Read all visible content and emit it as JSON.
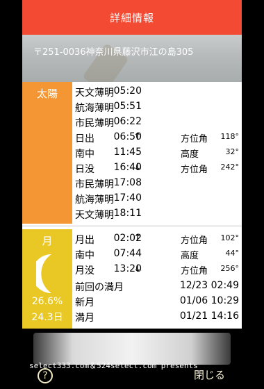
{
  "header": {
    "title": "詳細情報"
  },
  "address": "〒251-0036神奈川県藤沢市江の島305",
  "sun": {
    "label": "太陽",
    "rows": [
      {
        "name": "天文薄明",
        "arrow": "",
        "time": "05:20",
        "ext_label": "",
        "ext_value": ""
      },
      {
        "name": "航海薄明",
        "arrow": "",
        "time": "05:51",
        "ext_label": "",
        "ext_value": ""
      },
      {
        "name": "市民薄明",
        "arrow": "",
        "time": "06:22",
        "ext_label": "",
        "ext_value": ""
      },
      {
        "name": "日出",
        "arrow": "↑",
        "time": "06:50",
        "ext_label": "方位角",
        "ext_value": "118°"
      },
      {
        "name": "南中",
        "arrow": "",
        "time": "11:45",
        "ext_label": "高度",
        "ext_value": "32°"
      },
      {
        "name": "日没",
        "arrow": "↓",
        "time": "16:40",
        "ext_label": "方位角",
        "ext_value": "242°"
      },
      {
        "name": "市民薄明",
        "arrow": "",
        "time": "17:08",
        "ext_label": "",
        "ext_value": ""
      },
      {
        "name": "航海薄明",
        "arrow": "",
        "time": "17:40",
        "ext_label": "",
        "ext_value": ""
      },
      {
        "name": "天文薄明",
        "arrow": "",
        "time": "18:11",
        "ext_label": "",
        "ext_value": ""
      }
    ]
  },
  "moon": {
    "label": "月",
    "illumination": "26.6%",
    "age": "24.3日",
    "rows": [
      {
        "name": "月出",
        "arrow": "↑",
        "time": "02:02",
        "ext_label": "方位角",
        "ext_value": "102°"
      },
      {
        "name": "南中",
        "arrow": "",
        "time": "07:44",
        "ext_label": "高度",
        "ext_value": "44°"
      },
      {
        "name": "月没",
        "arrow": "↓",
        "time": "13:20",
        "ext_label": "方位角",
        "ext_value": "256°"
      }
    ],
    "phases": [
      {
        "name": "前回の満月",
        "datetime": "12/23 02:49"
      },
      {
        "name": "新月",
        "datetime": "01/06 10:29"
      },
      {
        "name": "満月",
        "datetime": "01/21 14:16"
      }
    ]
  },
  "footer": {
    "credit": "select333.com＆524select.com presents",
    "help": "?",
    "close": "閉じる"
  }
}
